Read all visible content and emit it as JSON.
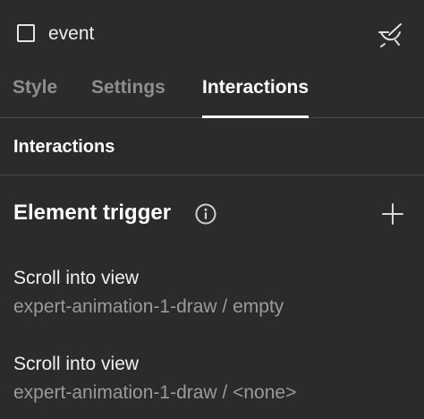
{
  "header": {
    "element_name": "event",
    "checkbox_icon": "checkbox-icon",
    "brush_icon": "style-brush-icon"
  },
  "tabs": [
    {
      "label": "Style",
      "active": false
    },
    {
      "label": "Settings",
      "active": false
    },
    {
      "label": "Interactions",
      "active": true
    }
  ],
  "section": {
    "title": "Interactions"
  },
  "element_trigger": {
    "title": "Element trigger",
    "info_icon": "info-icon",
    "add_icon": "plus-icon",
    "items": [
      {
        "type": "Scroll into view",
        "target": "expert-animation-1-draw / empty"
      },
      {
        "type": "Scroll into view",
        "target": "expert-animation-1-draw / <none>"
      }
    ]
  },
  "colors": {
    "background": "#2b2b2b",
    "active_tab": "#ffffff",
    "inactive_tab": "#8e8e8e",
    "secondary_text": "#9a9a9a",
    "divider": "#4a4a4a"
  }
}
